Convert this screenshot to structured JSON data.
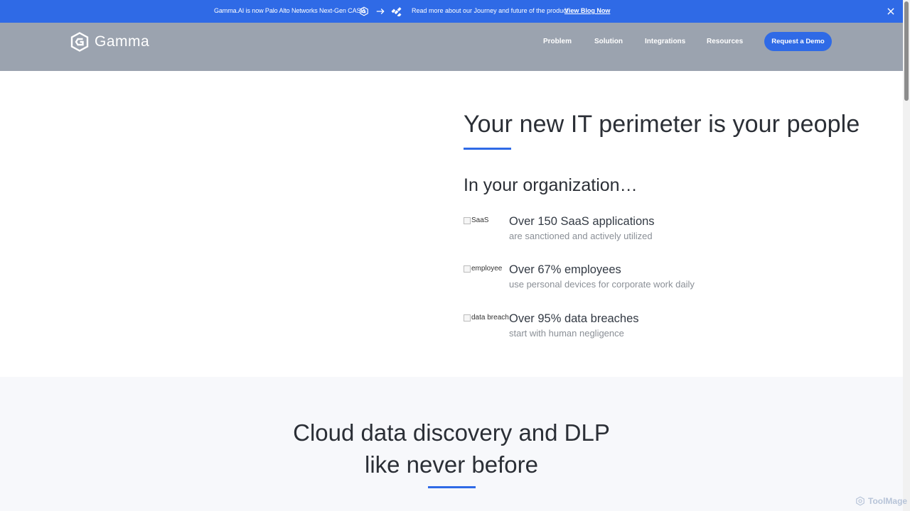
{
  "announcement": {
    "message": "Gamma.AI is now Palo Alto Networks Next-Gen CASB",
    "read_more": "Read more about our Journey and future of the product",
    "link_label": "View Blog Now"
  },
  "header": {
    "logo_text": "Gamma",
    "nav": [
      {
        "label": "Problem"
      },
      {
        "label": "Solution"
      },
      {
        "label": "Integrations"
      },
      {
        "label": "Resources"
      }
    ],
    "cta_label": "Request a Demo"
  },
  "hero": {
    "title": "Your new IT perimeter is your people",
    "subheading": "In your organization…",
    "stats": [
      {
        "alt": "SaaS",
        "headline": "Over 150 SaaS applications",
        "sub": "are sanctioned and actively utilized"
      },
      {
        "alt": "employee",
        "headline": "Over 67% employees",
        "sub": "use personal devices for corporate work daily"
      },
      {
        "alt": "data breach",
        "headline": "Over 95% data breaches",
        "sub": "start with human negligence"
      }
    ]
  },
  "section2": {
    "title_line1": "Cloud data discovery and DLP",
    "title_line2": "like never before"
  },
  "watermark": "ToolMage",
  "colors": {
    "accent": "#2f6ae6",
    "header_bg": "#9ba3af",
    "section_bg": "#f7f8fb"
  }
}
